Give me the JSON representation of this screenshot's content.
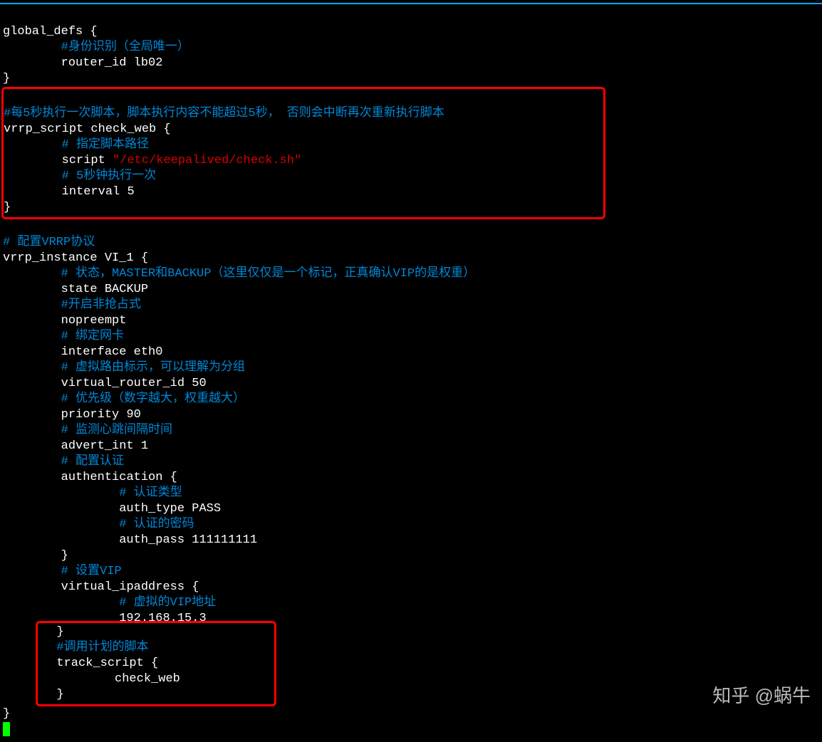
{
  "code": {
    "l1": "global_defs {",
    "l2_comment": "#身份识别（全局唯一）",
    "l3": "router_id lb02",
    "l4": "}",
    "box1": {
      "c1a": "#每",
      "c1b": "5",
      "c1c": "秒执行一次脚本，脚本执行内容不能超过",
      "c1d": "5",
      "c1e": "秒， 否则会中断再次重新执行脚本",
      "l6": "vrrp_script check_web {",
      "c2": "# 指定脚本路径",
      "l8a": "script ",
      "l8b": "\"/etc/keepalived/check.sh\"",
      "c3a": "# ",
      "c3b": "5",
      "c3c": "秒钟执行一次",
      "l10": "interval 5",
      "l11": "}"
    },
    "c4a": "# 配置",
    "c4b": "VRRP",
    "c4c": "协议",
    "l13": "vrrp_instance VI_1 {",
    "c5a": "# 状态，",
    "c5b": "MASTER",
    "c5c": "和",
    "c5d": "BACKUP",
    "c5e": "（这里仅仅是一个标记，正真确认",
    "c5f": "VIP",
    "c5g": "的是权重）",
    "l15": "state BACKUP",
    "c6": "#开启非抢占式",
    "l17": "nopreempt",
    "c7": "# 绑定网卡",
    "l19": "interface eth0",
    "c8": "# 虚拟路由标示，可以理解为分组",
    "l21": "virtual_router_id 50",
    "c9": "# 优先级（数字越大，权重越大）",
    "l23": "priority 90",
    "c10": "# 监测心跳间隔时间",
    "l25": "advert_int 1",
    "c11": "# 配置认证",
    "l27": "authentication {",
    "c12": "# 认证类型",
    "l29": "auth_type PASS",
    "c13": "# 认证的密码",
    "l31": "auth_pass 111111111",
    "l32": "}",
    "c14a": "# 设置",
    "c14b": "VIP",
    "l34": "virtual_ipaddress {",
    "c15a": "# 虚拟的",
    "c15b": "VIP",
    "c15c": "地址",
    "l36": "192.168.15.3",
    "box2": {
      "l37": "}",
      "c16": "#调用计划的脚本",
      "l38": "track_script {",
      "l39": "check_web",
      "l40": "}"
    },
    "l41": "}"
  },
  "watermark": "知乎 @蜗牛"
}
